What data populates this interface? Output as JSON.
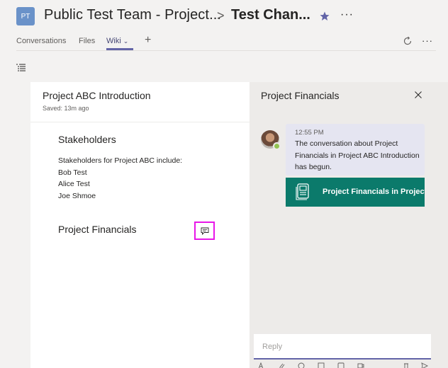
{
  "header": {
    "team_initials": "PT",
    "team_name": "Public Test Team - Project...",
    "separator": ">",
    "channel_name": "Test Chan...",
    "more": "···"
  },
  "tabs": {
    "items": [
      {
        "label": "Conversations"
      },
      {
        "label": "Files"
      },
      {
        "label": "Wiki"
      }
    ],
    "add": "+",
    "more": "···"
  },
  "wiki": {
    "title": "Project ABC Introduction",
    "saved": "Saved: 13m ago",
    "sections": [
      {
        "heading": "Stakeholders",
        "lines": [
          "Stakeholders for Project ABC include:",
          "Bob Test",
          "Alice Test",
          "Joe Shmoe"
        ]
      },
      {
        "heading": "Project Financials"
      }
    ]
  },
  "conversation": {
    "title": "Project Financials",
    "message": {
      "time": "12:55 PM",
      "text": "The conversation about Project Financials in Project ABC Introduction has begun."
    },
    "card_text": "Project Financials in Project ABC Introduction",
    "reply_placeholder": "Reply"
  },
  "colors": {
    "accent": "#6264a7",
    "card": "#0b7a6b",
    "highlight": "#e817e8",
    "star": "#6264a7"
  }
}
